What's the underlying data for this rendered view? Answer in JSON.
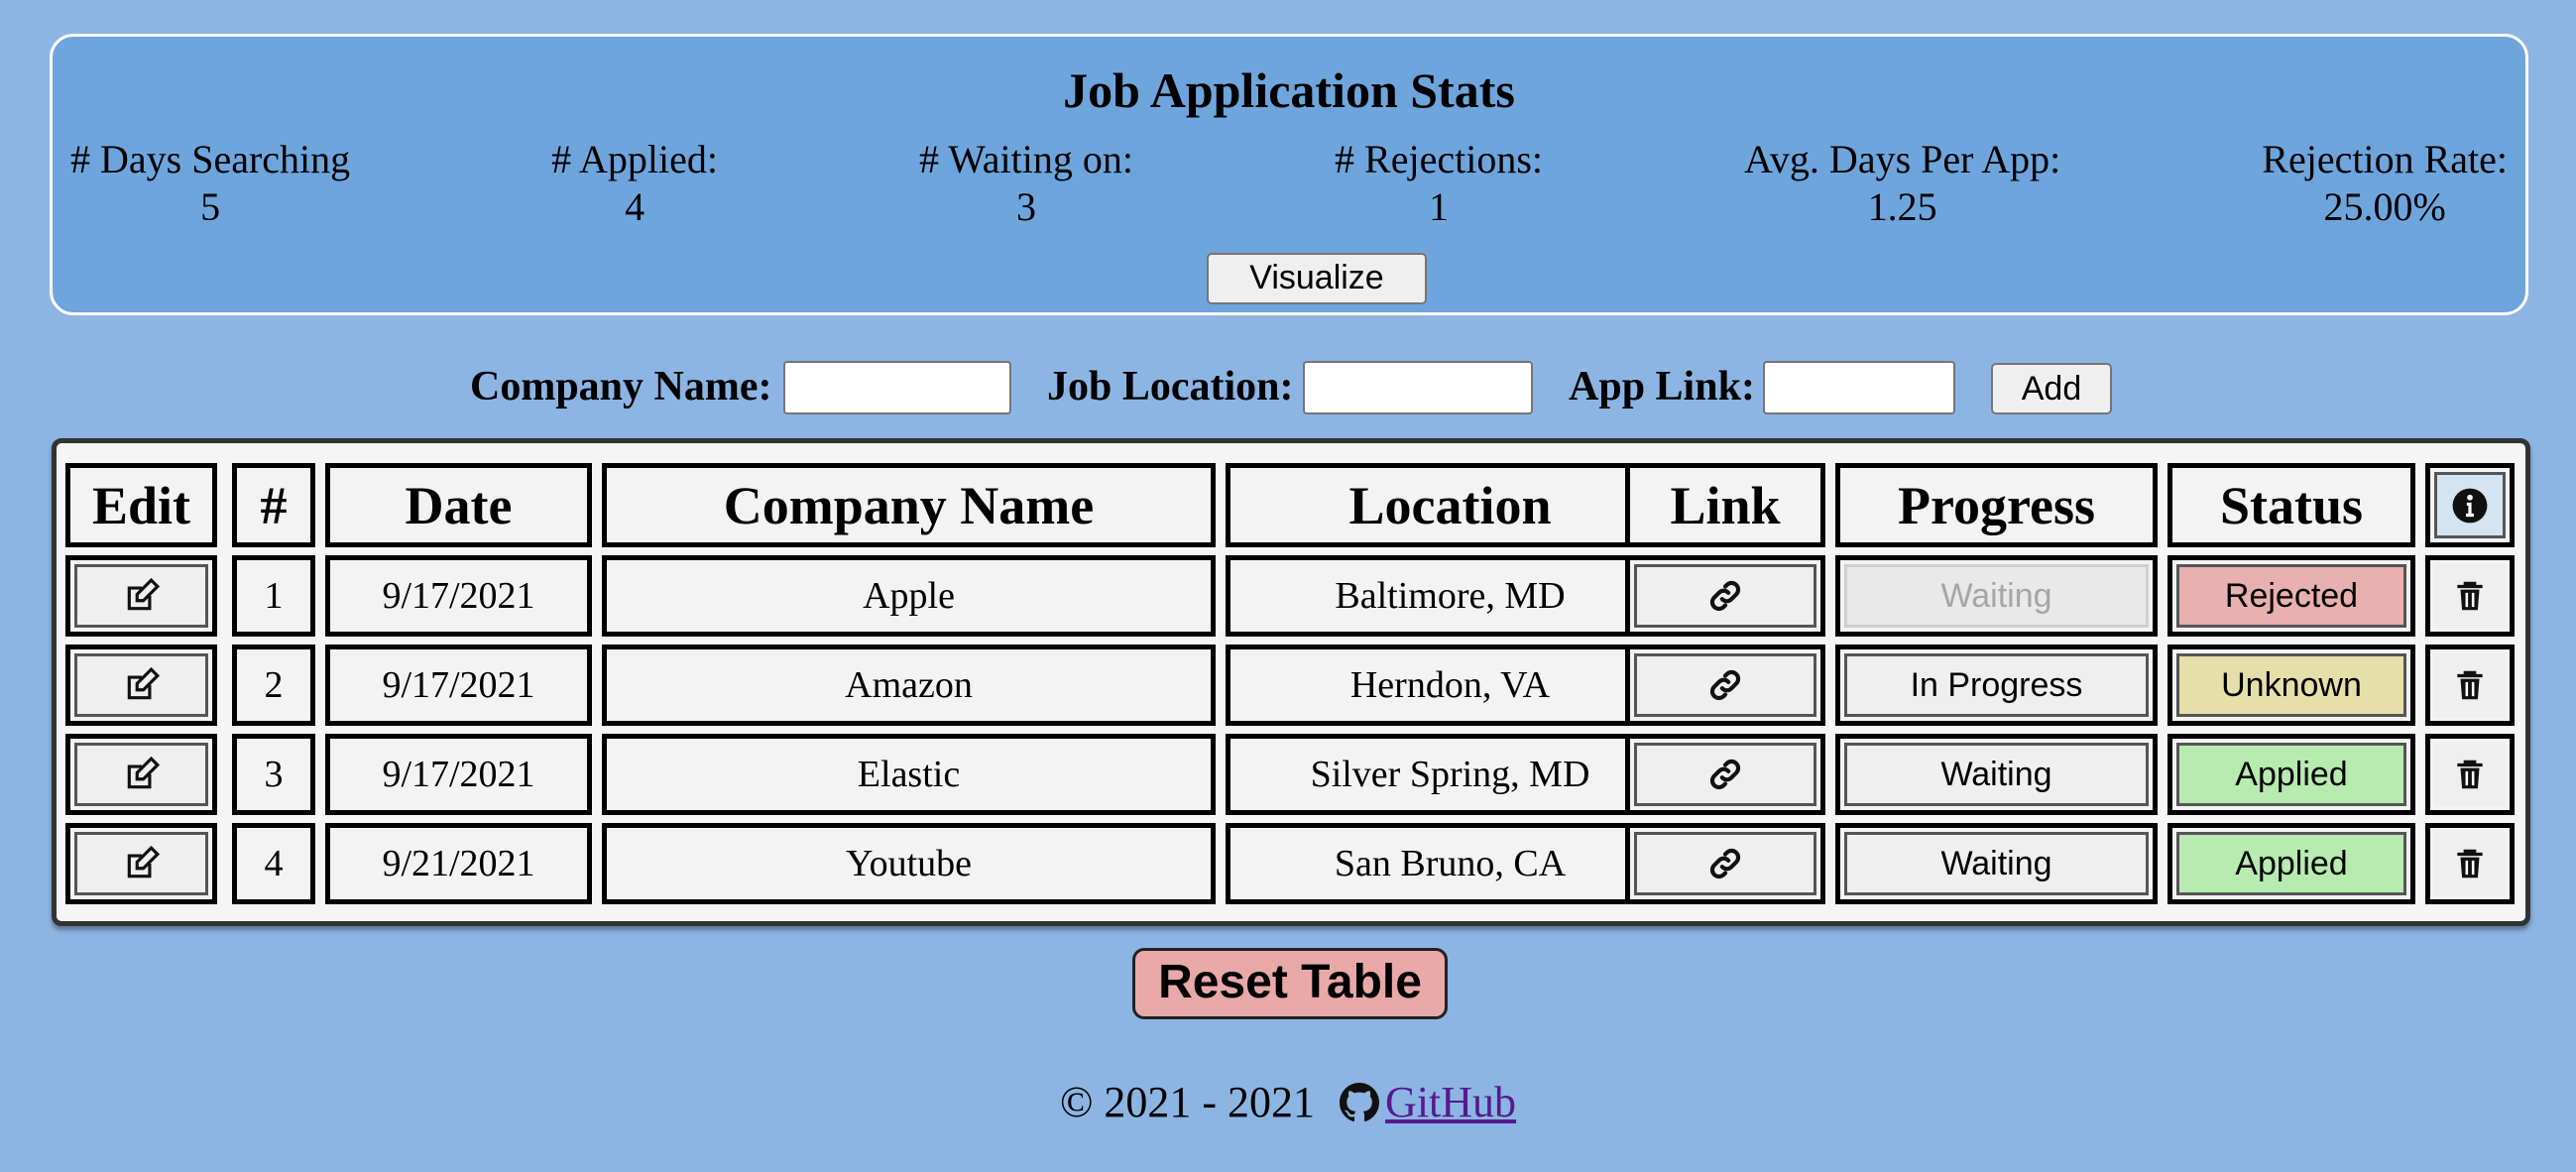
{
  "stats": {
    "title": "Job Application Stats",
    "items": [
      {
        "label": "# Days Searching",
        "value": "5"
      },
      {
        "label": "# Applied:",
        "value": "4"
      },
      {
        "label": "# Waiting on:",
        "value": "3"
      },
      {
        "label": "# Rejections:",
        "value": "1"
      },
      {
        "label": "Avg. Days Per App:",
        "value": "1.25"
      },
      {
        "label": "Rejection Rate:",
        "value": "25.00%"
      }
    ],
    "visualize_label": "Visualize"
  },
  "form": {
    "company_label": "Company Name:",
    "location_label": "Job Location:",
    "link_label": "App Link:",
    "company_value": "",
    "location_value": "",
    "link_value": "",
    "add_label": "Add"
  },
  "table": {
    "headers": {
      "edit": "Edit",
      "num": "#",
      "date": "Date",
      "company": "Company Name",
      "location": "Location",
      "link": "Link",
      "progress": "Progress",
      "status": "Status"
    },
    "header_icon": "info-icon",
    "row_icons": {
      "edit": "edit-icon",
      "link": "link-icon",
      "delete": "trash-icon"
    },
    "status_colors": {
      "Rejected": "#e8b0ae",
      "Unknown": "#e5dfa9",
      "Applied": "#b7ebb0"
    },
    "rows": [
      {
        "num": "1",
        "date": "9/17/2021",
        "company": "Apple",
        "location": "Baltimore, MD",
        "progress": "Waiting",
        "progress_disabled": true,
        "status": "Rejected"
      },
      {
        "num": "2",
        "date": "9/17/2021",
        "company": "Amazon",
        "location": "Herndon, VA",
        "progress": "In Progress",
        "progress_disabled": false,
        "status": "Unknown"
      },
      {
        "num": "3",
        "date": "9/17/2021",
        "company": "Elastic",
        "location": "Silver Spring, MD",
        "progress": "Waiting",
        "progress_disabled": false,
        "status": "Applied"
      },
      {
        "num": "4",
        "date": "9/21/2021",
        "company": "Youtube",
        "location": "San Bruno, CA",
        "progress": "Waiting",
        "progress_disabled": false,
        "status": "Applied"
      }
    ]
  },
  "reset_label": "Reset Table",
  "footer": {
    "copyright": "© 2021 - 2021",
    "github_label": "GitHub",
    "github_icon": "github-icon"
  }
}
